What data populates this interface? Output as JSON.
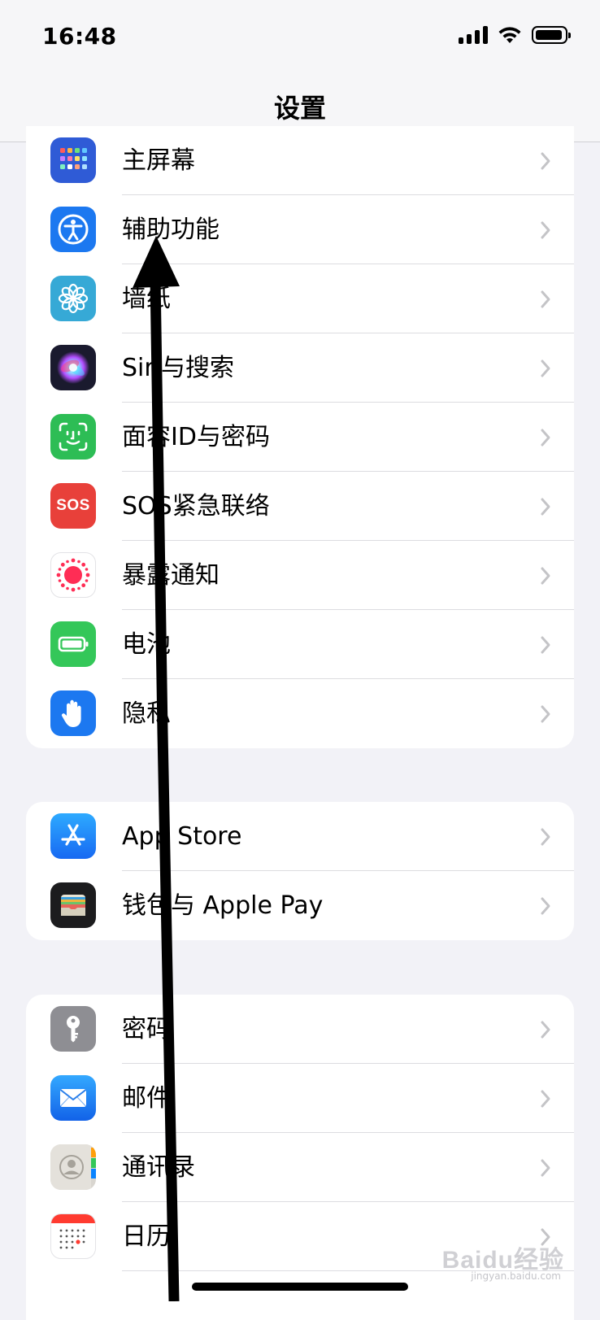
{
  "status": {
    "time": "16:48"
  },
  "nav": {
    "title": "设置"
  },
  "groups": [
    {
      "items": [
        {
          "label": "主屏幕",
          "icon": "home-screen-icon",
          "color": "#2f5bd6"
        },
        {
          "label": "辅助功能",
          "icon": "accessibility-icon",
          "color": "#1c78f0"
        },
        {
          "label": "墙纸",
          "icon": "wallpaper-flower-icon",
          "color": "#36a9d6"
        },
        {
          "label": "Siri与搜索",
          "icon": "siri-icon",
          "color": "#1a1a2e"
        },
        {
          "label": "面容ID与密码",
          "icon": "face-id-icon",
          "color": "#2dbd55"
        },
        {
          "label": "SOS紧急联络",
          "icon": "sos-icon",
          "color": "#e8403a"
        },
        {
          "label": "暴露通知",
          "icon": "exposure-notification-icon",
          "color": "#ffffff"
        },
        {
          "label": "电池",
          "icon": "battery-icon",
          "color": "#34c759"
        },
        {
          "label": "隐私",
          "icon": "privacy-hand-icon",
          "color": "#1c78f0"
        }
      ]
    },
    {
      "items": [
        {
          "label": "App Store",
          "icon": "app-store-icon",
          "color": "#1c8bf5"
        },
        {
          "label": "钱包与 Apple Pay",
          "icon": "wallet-icon",
          "color": "#1c1c1e"
        }
      ]
    },
    {
      "items": [
        {
          "label": "密码",
          "icon": "passwords-key-icon",
          "color": "#8e8e93"
        },
        {
          "label": "邮件",
          "icon": "mail-icon",
          "color": "#1e86f0"
        },
        {
          "label": "通讯录",
          "icon": "contacts-icon",
          "color": "#d9d6d0"
        },
        {
          "label": "日历",
          "icon": "calendar-icon",
          "color": "#ffffff"
        }
      ]
    }
  ],
  "icons": {
    "sos_text": "SOS"
  },
  "watermark": {
    "brand": "Baidu经验",
    "sub": "jingyan.baidu.com"
  }
}
